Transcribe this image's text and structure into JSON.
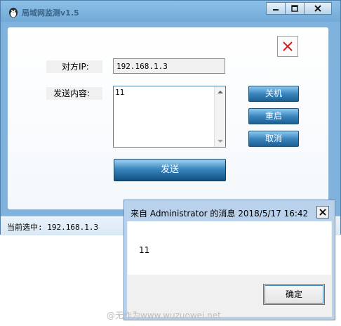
{
  "window": {
    "title": "局域网监测v1.5",
    "close_glyph": "✕"
  },
  "form": {
    "ip_label": "对方IP:",
    "ip_value": "192.168.1.3",
    "content_label": "发送内容:",
    "content_value": "11",
    "send_label": "发送"
  },
  "side_buttons": {
    "shutdown": "关机",
    "restart": "重启",
    "cancel": "取消"
  },
  "status": {
    "text": "当前选中: 192.168.1.3"
  },
  "dialog": {
    "title": "来自 Administrator 的消息 2018/5/17 16:42",
    "message": "11",
    "ok_label": "确定"
  },
  "watermark": {
    "text": "@无作为www.wuzuowei.net"
  },
  "colors": {
    "frame": "#7fb2dc",
    "button_blue": "#3b86be",
    "dialog_title": "#b9d1ea"
  }
}
